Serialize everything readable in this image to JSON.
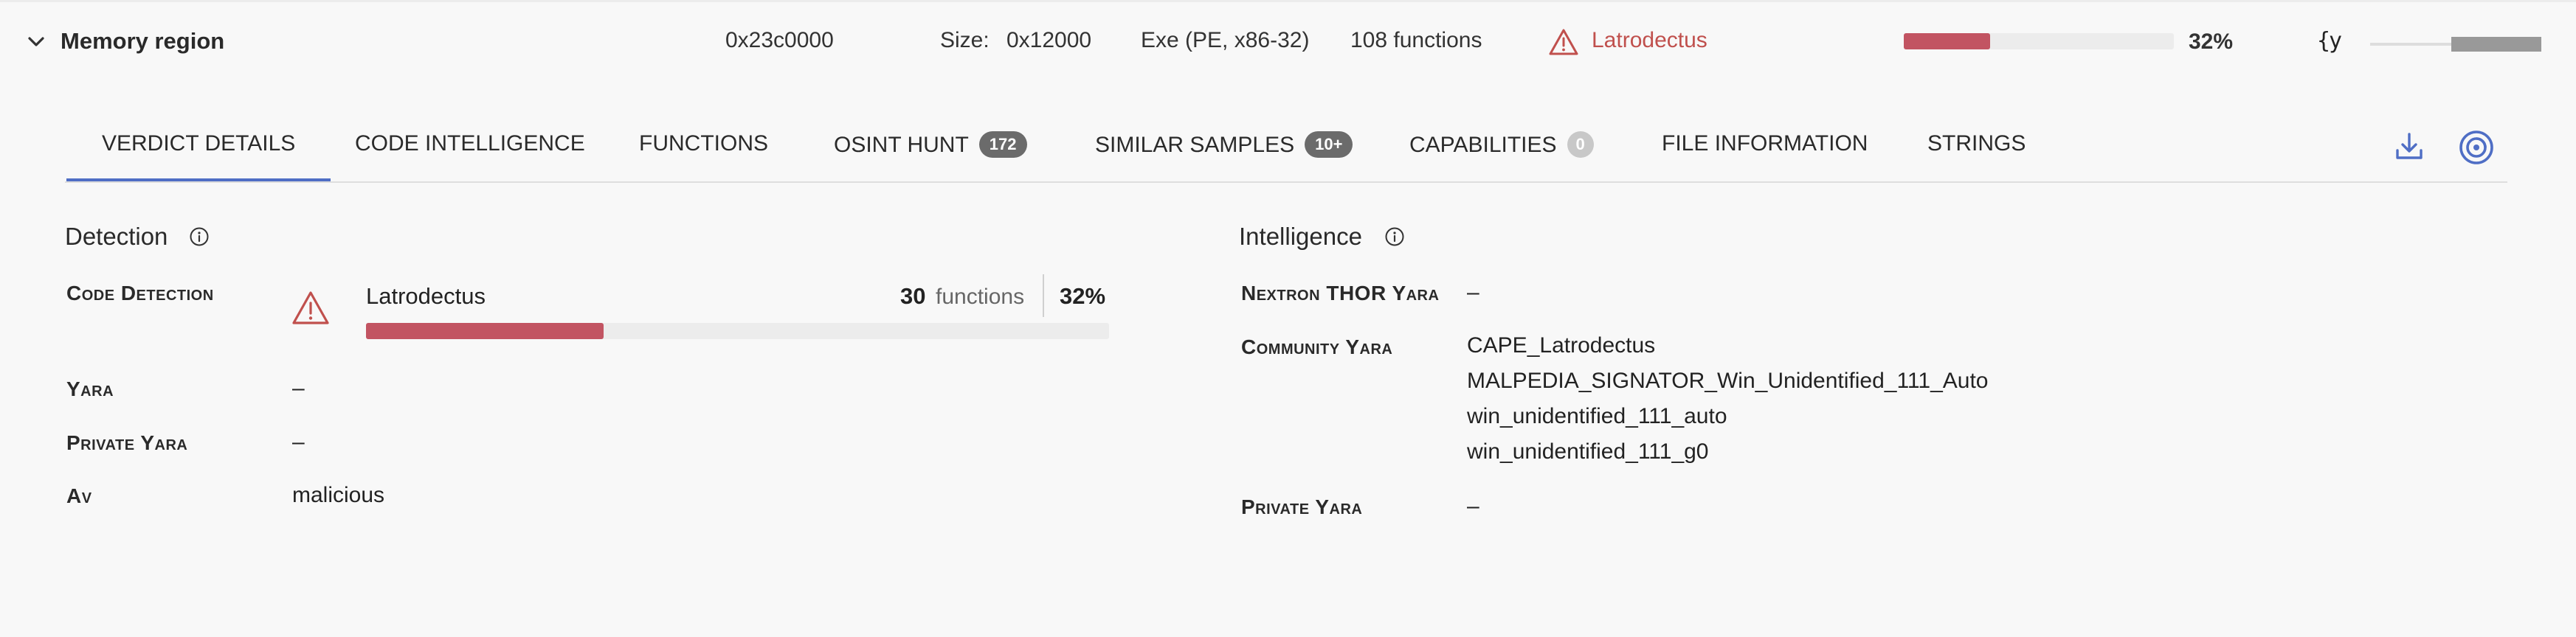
{
  "header": {
    "title": "Memory region",
    "address": "0x23c0000",
    "size_label": "Size:",
    "size_value": "0x12000",
    "format": "Exe (PE, x86-32)",
    "functions": "108 functions",
    "family": "Latrodectus",
    "match_fraction": 0.32,
    "match_percent": "32%",
    "glyph": "{y",
    "icons": [
      "chevron-down-icon",
      "warning-triangle-icon"
    ]
  },
  "tabs": [
    {
      "label": "VERDICT DETAILS",
      "active": true
    },
    {
      "label": "CODE INTELLIGENCE"
    },
    {
      "label": "FUNCTIONS"
    },
    {
      "label": "OSINT HUNT",
      "badge": "172"
    },
    {
      "label": "SIMILAR SAMPLES",
      "badge": "10+"
    },
    {
      "label": "CAPABILITIES",
      "badge": "0"
    },
    {
      "label": "FILE INFORMATION"
    },
    {
      "label": "STRINGS"
    }
  ],
  "toolbar_icons": [
    "download-icon",
    "target-icon"
  ],
  "detection": {
    "title": "Detection",
    "code_detection": {
      "label": "Code Detection",
      "name": "Latrodectus",
      "count": "30",
      "unit": "functions",
      "percent": "32%",
      "fraction": 0.32
    },
    "yara": {
      "label": "Yara",
      "value": "–"
    },
    "private_yara": {
      "label": "Private Yara",
      "value": "–"
    },
    "av": {
      "label": "Av",
      "value": "malicious"
    }
  },
  "intelligence": {
    "title": "Intelligence",
    "nextron": {
      "label": "Nextron THOR Yara",
      "value": "–"
    },
    "community": {
      "label": "Community Yara",
      "values": [
        "CAPE_Latrodectus",
        "MALPEDIA_SIGNATOR_Win_Unidentified_111_Auto",
        "win_unidentified_111_auto",
        "win_unidentified_111_g0"
      ]
    },
    "private_yara": {
      "label": "Private Yara",
      "value": "–"
    }
  },
  "colors": {
    "accent": "#4f6ec5",
    "danger": "#c0504d",
    "bar": "#c25462"
  }
}
